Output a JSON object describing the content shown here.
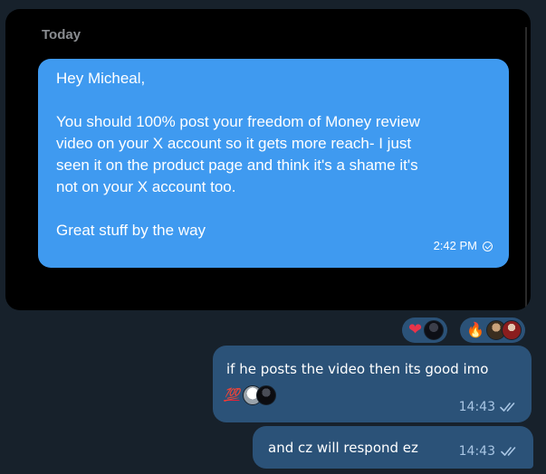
{
  "screenshot": {
    "date_label": "Today",
    "message": {
      "lines": [
        "Hey Micheal,",
        "",
        "You should 100% post your freedom of Money review",
        "video on your X account so it gets more reach- I just",
        "seen it on the product page and think it's a shame it's",
        "not on your X account too.",
        "",
        "Great stuff by the way"
      ],
      "time": "2:42 PM",
      "status_icon": "check-circle-icon"
    },
    "colors": {
      "bubble": "#3f9af0",
      "background": "#000000"
    }
  },
  "reactions": [
    {
      "emoji": "❤",
      "icon": "heart-icon",
      "avatars": [
        "dark-hooded-avatar"
      ]
    },
    {
      "emoji": "🔥",
      "icon": "fire-icon",
      "avatars": [
        "soldier-avatar",
        "red-character-avatar"
      ]
    }
  ],
  "outgoing": [
    {
      "text": "if he posts the video then its good imo",
      "time": "14:43",
      "reaction_emoji": "💯",
      "reaction_avatars": [
        "white-sketch-avatar",
        "black-avatar"
      ],
      "status": "read"
    },
    {
      "text": "and cz will respond ez",
      "time": "14:43",
      "status": "read"
    }
  ],
  "colors": {
    "chat_background": "#17212b",
    "outgoing_bubble": "#2b5278",
    "time_text": "#a9c6e4"
  }
}
